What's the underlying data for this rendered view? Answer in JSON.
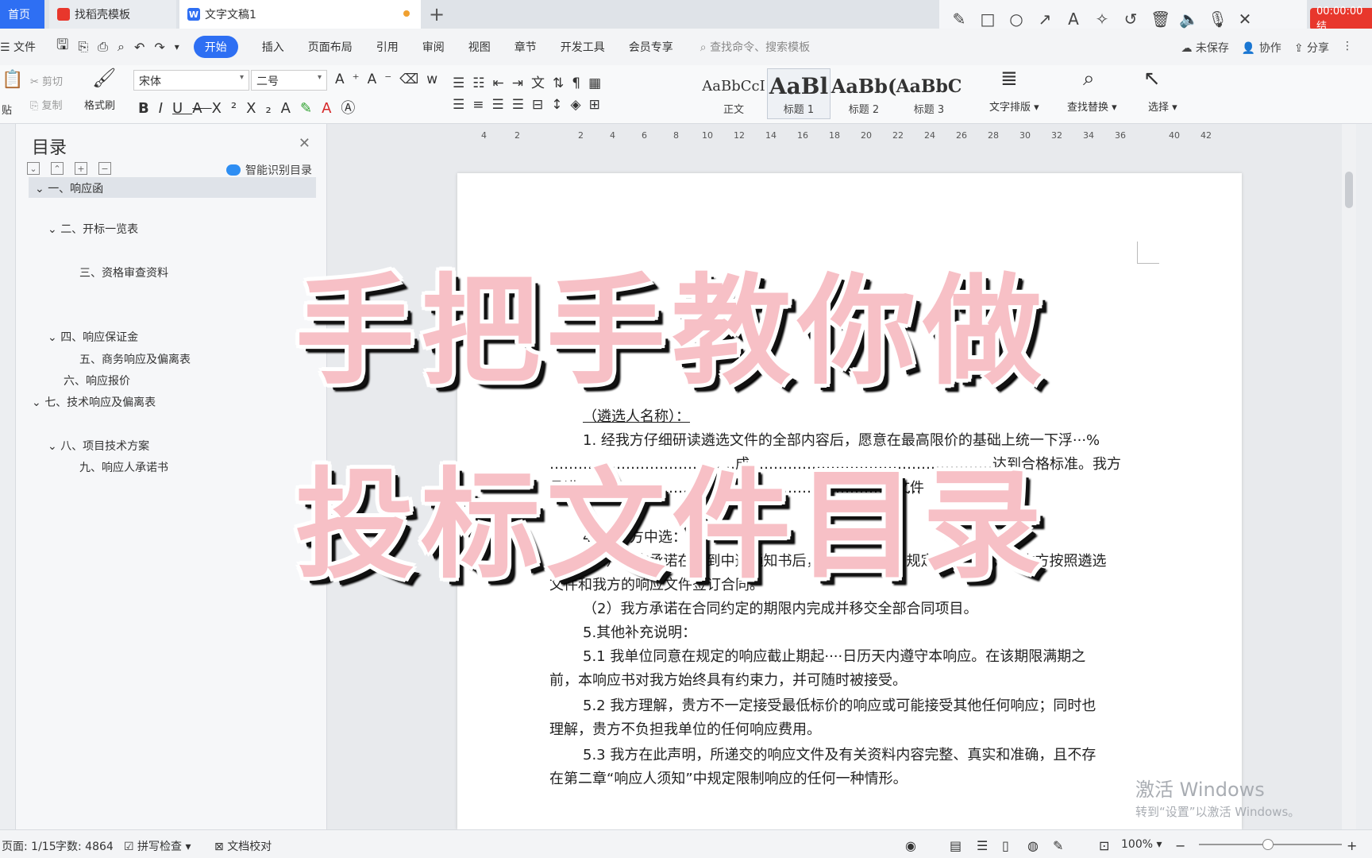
{
  "tabs": {
    "home": "首页",
    "templates": "找稻壳模板",
    "document": "文字文稿1"
  },
  "recorder": {
    "time": "00:00:00 结"
  },
  "menu": {
    "file": "文件",
    "items": [
      "开始",
      "插入",
      "页面布局",
      "引用",
      "审阅",
      "视图",
      "章节",
      "开发工具",
      "会员专享"
    ],
    "search": "查找命令、搜索模板",
    "unsaved": "未保存",
    "collab": "协作",
    "share": "分享"
  },
  "ribbon": {
    "paste": "贴",
    "cut": "剪切",
    "copy": "复制",
    "format_painter": "格式刷",
    "font": "宋体",
    "size": "二号",
    "styles": [
      {
        "sample": "AaBbCcI",
        "name": "正文"
      },
      {
        "sample": "AaBl",
        "name": "标题 1"
      },
      {
        "sample": "AaBb(",
        "name": "标题 2"
      },
      {
        "sample": "AaBbC",
        "name": "标题 3"
      }
    ],
    "text_layout": "文字排版",
    "find_replace": "查找替换",
    "select": "选择"
  },
  "toc": {
    "title": "目录",
    "smart": "智能识别目录",
    "items": [
      "一、响应函",
      "二、开标一览表",
      "三、资格审查资料",
      "四、响应保证金",
      "五、商务响应及偏离表",
      "六、响应报价",
      "七、技术响应及偏离表",
      "八、项目技术方案",
      "九、响应人承诺书"
    ]
  },
  "ruler": {
    "marks": [
      "4",
      "2",
      "2",
      "4",
      "6",
      "8",
      "10",
      "12",
      "14",
      "16",
      "18",
      "20",
      "22",
      "24",
      "26",
      "28",
      "30",
      "32",
      "34",
      "36",
      "40",
      "42"
    ]
  },
  "document": {
    "lines": [
      "（遴选人名称）：",
      "1. 经我方仔细研读遴选文件的全部内容后，愿意在最高限价的基础上统一下浮···%",
      "…………………………………成……………………………………………达到合格标准。我方",
      "承诺………………………………………………………………",
      "4. 如我方中选：",
      "（1）我方承诺在收到中选通知书后，在中选通知书规定的期限内，与你方按照遴选",
      "文件和我方的响应文件签订合同。",
      "（2）我方承诺在合同约定的期限内完成并移交全部合同项目。",
      "5.其他补充说明：",
      "5.1 我单位同意在规定的响应截止期起····日历天内遵守本响应。在该期限满期之",
      "前，本响应书对我方始终具有约束力，并可随时被接受。",
      "5.2 我方理解，贵方不一定接受最低标价的响应或可能接受其他任何响应；同时也",
      "理解，贵方不负担我单位的任何响应费用。",
      "5.3 我方在此声明，所递交的响应文件及有关资料内容完整、真实和准确，且不存",
      "在第二章“响应人须知”中规定限制响应的任何一种情形。"
    ],
    "fragment_a": "已经",
    "fragment_b": "文件"
  },
  "overlay": {
    "line1": "手把手教你做",
    "line2": "投标文件目录"
  },
  "watermark": {
    "line1": "激活 Windows",
    "line2": "转到“设置”以激活 Windows。"
  },
  "status": {
    "page": "页面: 1/15",
    "words": "字数: 4864",
    "spell": "拼写检查",
    "proof": "文档校对",
    "zoom": "100%"
  }
}
